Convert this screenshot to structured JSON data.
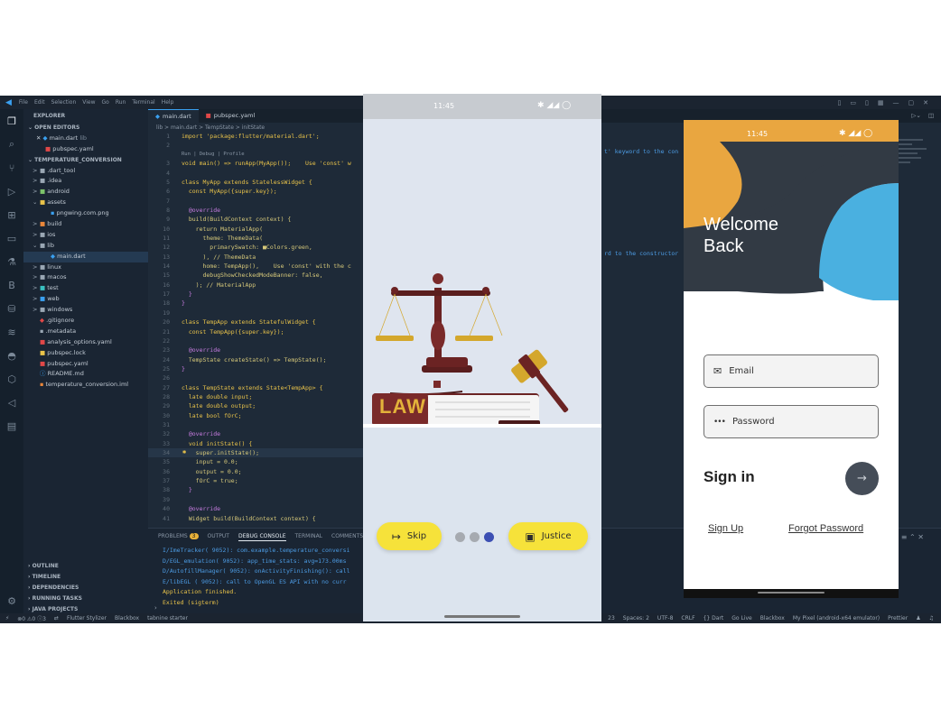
{
  "titlebar": {
    "menu": [
      "File",
      "Edit",
      "Selection",
      "View",
      "Go",
      "Run",
      "Terminal",
      "Help"
    ]
  },
  "explorer": {
    "title": "EXPLORER",
    "open_editors_label": "OPEN EDITORS",
    "open_editors": [
      "main.dart",
      "lib",
      "pubspec.yaml"
    ],
    "project": "TEMPERATURE_CONVERSION",
    "tree": [
      ".dart_tool",
      ".idea",
      "android",
      "assets",
      "pngwing.com.png",
      "build",
      "ios",
      "lib",
      "main.dart",
      "linux",
      "macos",
      "test",
      "web",
      "windows",
      ".gitignore",
      ".metadata",
      "analysis_options.yaml",
      "pubspec.lock",
      "pubspec.yaml",
      "README.md",
      "temperature_conversion.iml"
    ],
    "sections": [
      "OUTLINE",
      "TIMELINE",
      "DEPENDENCIES",
      "RUNNING TASKS",
      "JAVA PROJECTS"
    ]
  },
  "editor": {
    "tabs": [
      "main.dart",
      "pubspec.yaml"
    ],
    "breadcrumb": "lib > main.dart > TempState > initState",
    "codelens": "Run | Debug | Profile",
    "lines": [
      {
        "n": "1",
        "t": "import 'package:flutter/material.dart';"
      },
      {
        "n": "2",
        "t": ""
      },
      {
        "n": "3",
        "t": "void main() => runApp(MyApp());    Use 'const' w"
      },
      {
        "n": "4",
        "t": ""
      },
      {
        "n": "5",
        "t": "class MyApp extends StatelessWidget {"
      },
      {
        "n": "6",
        "t": "  const MyApp({super.key});"
      },
      {
        "n": "7",
        "t": ""
      },
      {
        "n": "8",
        "t": "  @override"
      },
      {
        "n": "9",
        "t": "  build(BuildContext context) {"
      },
      {
        "n": "10",
        "t": "    return MaterialApp("
      },
      {
        "n": "11",
        "t": "      theme: ThemeData("
      },
      {
        "n": "12",
        "t": "        primarySwatch: ■Colors.green,"
      },
      {
        "n": "13",
        "t": "      ), // ThemeData"
      },
      {
        "n": "14",
        "t": "      home: TempApp(),    Use 'const' with the c"
      },
      {
        "n": "15",
        "t": "      debugShowCheckedModeBanner: false,"
      },
      {
        "n": "16",
        "t": "    ); // MaterialApp"
      },
      {
        "n": "17",
        "t": "  }"
      },
      {
        "n": "18",
        "t": "}"
      },
      {
        "n": "19",
        "t": ""
      },
      {
        "n": "20",
        "t": "class TempApp extends StatefulWidget {"
      },
      {
        "n": "21",
        "t": "  const TempApp({super.key});"
      },
      {
        "n": "22",
        "t": ""
      },
      {
        "n": "23",
        "t": "  @override"
      },
      {
        "n": "24",
        "t": "  TempState createState() => TempState();"
      },
      {
        "n": "25",
        "t": "}"
      },
      {
        "n": "26",
        "t": ""
      },
      {
        "n": "27",
        "t": "class TempState extends State<TempApp> {"
      },
      {
        "n": "28",
        "t": "  late double input;"
      },
      {
        "n": "29",
        "t": "  late double output;"
      },
      {
        "n": "30",
        "t": "  late bool fOrC;"
      },
      {
        "n": "31",
        "t": ""
      },
      {
        "n": "32",
        "t": "  @override"
      },
      {
        "n": "33",
        "t": "  void initState() {"
      },
      {
        "n": "34",
        "t": "    super.initState();"
      },
      {
        "n": "35",
        "t": "    input = 0.0;"
      },
      {
        "n": "36",
        "t": "    output = 0.0;"
      },
      {
        "n": "37",
        "t": "    fOrC = true;"
      },
      {
        "n": "38",
        "t": "  }"
      },
      {
        "n": "39",
        "t": ""
      },
      {
        "n": "40",
        "t": "  @override"
      },
      {
        "n": "41",
        "t": "  Widget build(BuildContext context) {"
      }
    ],
    "overflow_hint_1": "t' keyword to the con",
    "overflow_hint_2": "rd to the constructor"
  },
  "panel": {
    "tabs": [
      "PROBLEMS",
      "OUTPUT",
      "DEBUG CONSOLE",
      "TERMINAL",
      "COMMENTS"
    ],
    "problems_count": "3",
    "output": [
      "I/ImeTracker( 9052): com.example.temperature_conversi",
      "D/EGL_emulation( 9052): app_time_stats: avg=173.00ms",
      "D/AutofillManager( 9052): onActivityFinishing(): call",
      "E/libEGL  ( 9052): call to OpenGL ES API with no curr",
      "Application finished.",
      "Exited (sigterm)"
    ]
  },
  "statusbar": {
    "left": [
      "⊗0 ⚠0 ⓘ3",
      "Flutter Stylizer",
      "Blackbox",
      "tabnine starter"
    ],
    "right": [
      "23",
      "Spaces: 2",
      "UTF-8",
      "CRLF",
      "{} Dart",
      "Go Live",
      "Blackbox",
      "My Pixel (android-x64 emulator)",
      "Prettier"
    ]
  },
  "phone1": {
    "time": "11:45",
    "book_label": "LAW",
    "skip_label": "Skip",
    "justice_label": "Justice",
    "page_index": 3,
    "page_count": 3
  },
  "phone2": {
    "time": "11:45",
    "welcome": "Welcome\nBack",
    "email_placeholder": "Email",
    "password_placeholder": "Password",
    "sign_in": "Sign in",
    "sign_up": "Sign Up",
    "forgot": "Forgot Password"
  },
  "colors": {
    "ide_bg": "#1e2a38",
    "accent_yellow": "#f6e23a",
    "dot_active": "#3c4fb3",
    "dark_blob": "#323a44",
    "orange_blob": "#e9a640",
    "blue_blob": "#4ab0e0"
  }
}
